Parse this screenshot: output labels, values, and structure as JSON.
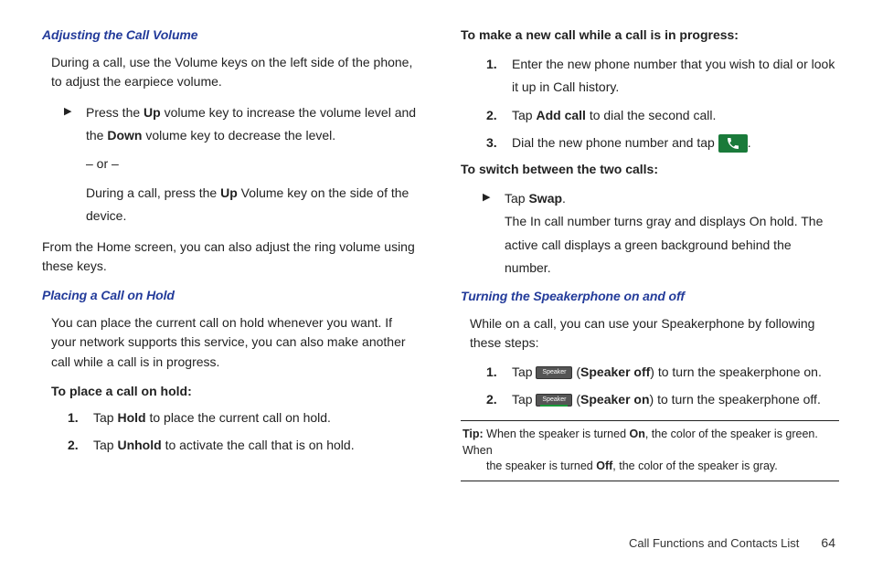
{
  "left": {
    "h1": "Adjusting the Call Volume",
    "p1": "During a call, use the Volume keys on the left side of the phone, to adjust the earpiece volume.",
    "b1a": "Press the ",
    "b1b": "Up",
    "b1c": " volume key to increase the volume level and the ",
    "b1d": "Down",
    "b1e": " volume key to decrease the level.",
    "or": "– or –",
    "b2a": "During a call, press the ",
    "b2b": "Up",
    "b2c": " Volume key on the side of the device.",
    "p2": "From the Home screen, you can also adjust the ring volume using these keys.",
    "h2": "Placing a Call on Hold",
    "p3": "You can place the current call on hold whenever you want. If your network supports this service, you can also make another call while a call is in progress.",
    "bh1": "To place a call on hold:",
    "o1num": "1.",
    "o1a": "Tap ",
    "o1b": "Hold",
    "o1c": " to place the current call on hold.",
    "o2num": "2.",
    "o2a": "Tap ",
    "o2b": "Unhold",
    "o2c": " to activate the call that is on hold."
  },
  "right": {
    "bh1": "To make a new call while a call is in progress:",
    "o1num": "1.",
    "o1": "Enter the new phone number that you wish to dial or look it up in Call history.",
    "o2num": "2.",
    "o2a": "Tap ",
    "o2b": "Add call",
    "o2c": " to dial the second call.",
    "o3num": "3.",
    "o3a": "Dial the new phone number and tap ",
    "o3b": ".",
    "bh2": "To switch between the two calls:",
    "sw1a": "Tap ",
    "sw1b": "Swap",
    "sw1c": ".",
    "sw2": "The In call number turns gray and displays On hold. The active call displays a green background behind the number.",
    "h3": "Turning the Speakerphone on and off",
    "p4": "While on a call, you can use your Speakerphone by following these steps:",
    "s1num": "1.",
    "s1a": "Tap ",
    "s1b": " (",
    "s1c": "Speaker off",
    "s1d": ") to turn the speakerphone on.",
    "s2num": "2.",
    "s2a": "Tap ",
    "s2b": " (",
    "s2c": "Speaker on",
    "s2d": ") to turn the speakerphone off.",
    "speaker_label": "Speaker",
    "tip_a": "Tip:",
    "tip_b": " When the speaker is turned ",
    "tip_c": "On",
    "tip_d": ", the color of the speaker is green. When ",
    "tip_e": "the speaker is turned ",
    "tip_f": "Off",
    "tip_g": ", the color of the speaker is gray."
  },
  "footer": {
    "section": "Call Functions and Contacts List",
    "page": "64"
  }
}
